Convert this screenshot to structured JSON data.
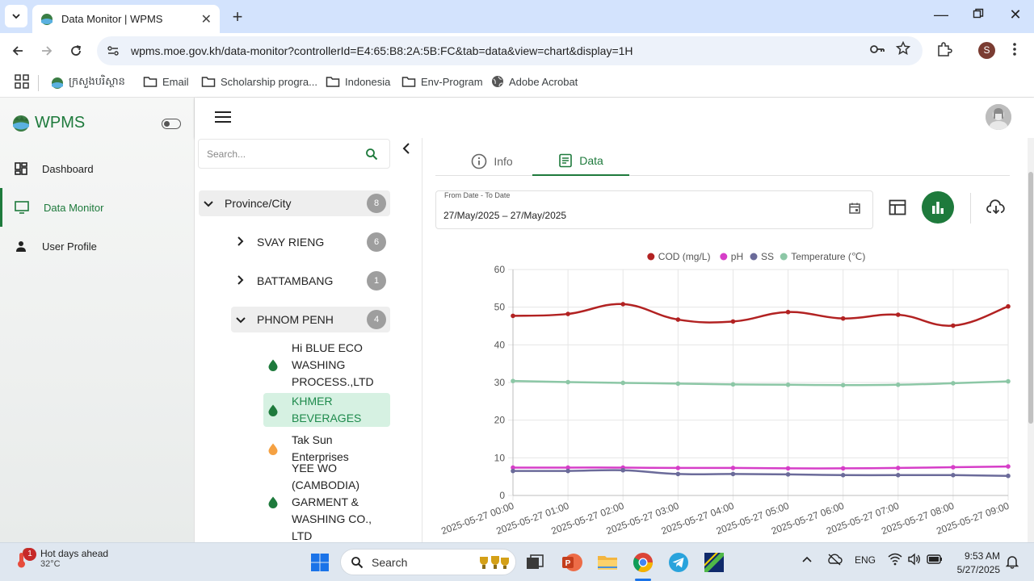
{
  "browser": {
    "tab_title": "Data Monitor | WPMS",
    "url": "wpms.moe.gov.kh/data-monitor?controllerId=E4:65:B8:2A:5B:FC&tab=data&view=chart&display=1H",
    "profile_initial": "S",
    "bookmarks": [
      "ក្រសួងបរិស្ថាន",
      "Email",
      "Scholarship progra...",
      "Indonesia",
      "Env-Program",
      "Adobe Acrobat"
    ]
  },
  "app": {
    "brand": "WPMS",
    "sidebar": [
      "Dashboard",
      "Data Monitor",
      "User Profile"
    ]
  },
  "tree": {
    "search_placeholder": "Search...",
    "root": {
      "label": "Province/City",
      "count": "8"
    },
    "provinces": [
      {
        "label": "SVAY RIENG",
        "count": "6"
      },
      {
        "label": "BATTAMBANG",
        "count": "1"
      },
      {
        "label": "PHNOM PENH",
        "count": "4"
      }
    ],
    "stations": [
      {
        "name": "Hi BLUE ECO WASHING PROCESS.,LTD",
        "status_color": "#1e7a3c"
      },
      {
        "name": "KHMER BEVERAGES",
        "status_color": "#1e7a3c"
      },
      {
        "name": "Tak Sun Enterprises",
        "status_color": "#f5a142"
      },
      {
        "name": "YEE WO (CAMBODIA) GARMENT & WASHING CO., LTD",
        "status_color": "#1e7a3c"
      }
    ]
  },
  "content": {
    "tabs": [
      "Info",
      "Data"
    ],
    "date_label": "From Date - To Date",
    "date_value": "27/May/2025 – 27/May/2025"
  },
  "chart_data": {
    "type": "line",
    "x": [
      "2025-05-27 00:00",
      "2025-05-27 01:00",
      "2025-05-27 02:00",
      "2025-05-27 03:00",
      "2025-05-27 04:00",
      "2025-05-27 05:00",
      "2025-05-27 06:00",
      "2025-05-27 07:00",
      "2025-05-27 08:00",
      "2025-05-27 09:00"
    ],
    "ylim": [
      0,
      60
    ],
    "yticks": [
      0,
      10,
      20,
      30,
      40,
      50,
      60
    ],
    "legend_position": "top",
    "grid": true,
    "series": [
      {
        "name": "COD (mg/L)",
        "color": "#b22222",
        "values": [
          47.7,
          48.2,
          50.8,
          46.7,
          46.2,
          48.7,
          47.0,
          48.0,
          45.1,
          50.2
        ]
      },
      {
        "name": "pH",
        "color": "#d63ec8",
        "values": [
          7.4,
          7.4,
          7.4,
          7.3,
          7.3,
          7.2,
          7.2,
          7.3,
          7.5,
          7.7
        ]
      },
      {
        "name": "SS",
        "color": "#6b6b9a",
        "values": [
          6.5,
          6.5,
          6.7,
          5.7,
          5.7,
          5.6,
          5.4,
          5.4,
          5.4,
          5.2
        ]
      },
      {
        "name": "Temperature (℃)",
        "color": "#8cc7a6",
        "values": [
          30.4,
          30.1,
          29.9,
          29.7,
          29.5,
          29.4,
          29.3,
          29.4,
          29.8,
          30.3
        ]
      }
    ]
  },
  "taskbar": {
    "weather_title": "Hot days ahead",
    "weather_temp": "32°C",
    "weather_badge": "1",
    "search": "Search",
    "lang": "ENG",
    "time": "9:53 AM",
    "date": "5/27/2025"
  }
}
